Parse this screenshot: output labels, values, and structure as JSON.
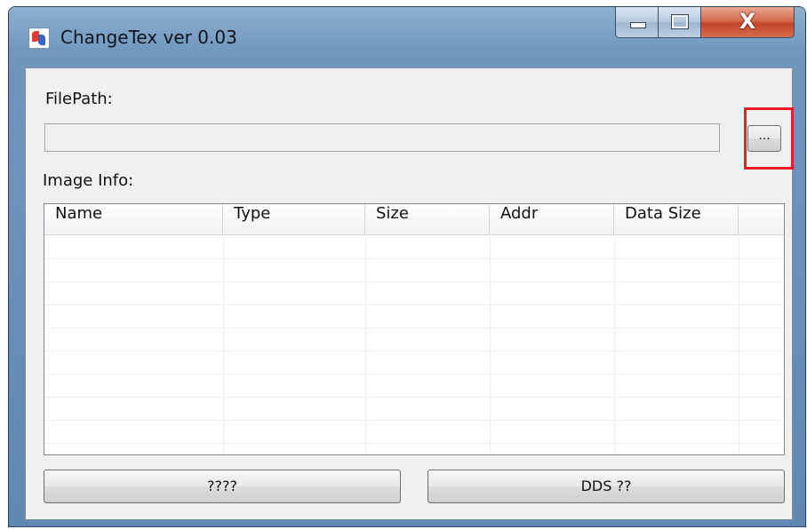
{
  "window": {
    "title": "ChangeTex ver 0.03"
  },
  "filepath": {
    "label": "FilePath:",
    "value": "",
    "browse_label": "..."
  },
  "image_info": {
    "label": "Image Info:",
    "columns": [
      "Name",
      "Type",
      "Size",
      "Addr",
      "Data Size"
    ],
    "rows": []
  },
  "buttons": {
    "left_label": "????",
    "right_label": "DDS ??"
  },
  "colors": {
    "highlight": "#ea1c24",
    "titlebar": "#6f96bd",
    "client_bg": "#f0f0f0"
  },
  "icons": {
    "app": "changetex-app-icon",
    "minimize": "minimize-icon",
    "maximize": "maximize-icon",
    "close": "close-icon"
  }
}
